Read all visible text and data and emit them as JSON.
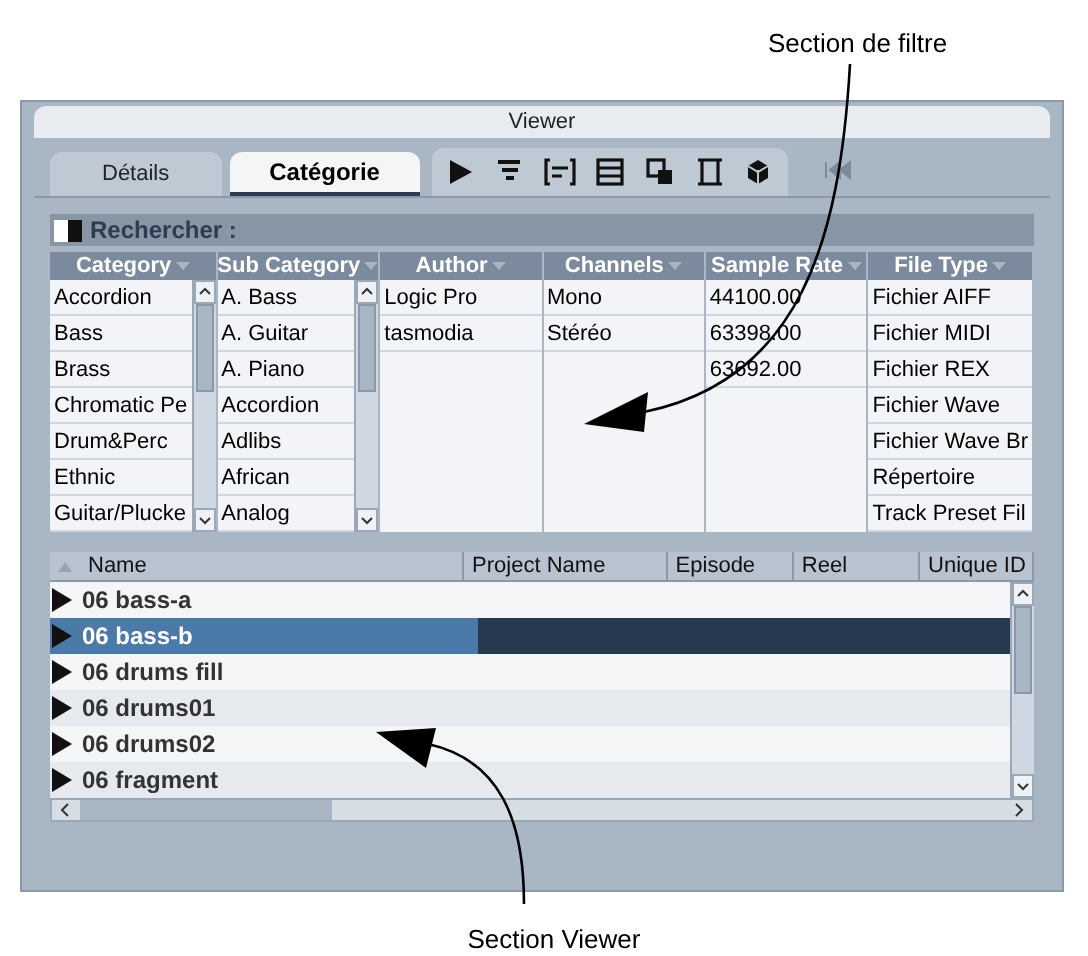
{
  "window": {
    "title": "Viewer"
  },
  "tabs": [
    {
      "label": "Détails",
      "selected": false
    },
    {
      "label": "Catégorie",
      "selected": true
    }
  ],
  "search": {
    "label": "Rechercher :"
  },
  "filter_columns": [
    {
      "header": "Category",
      "kind": "scroll-list",
      "items": [
        "Accordion",
        "Bass",
        "Brass",
        "Chromatic Pe",
        "Drum&Perc",
        "Ethnic",
        "Guitar/Plucke"
      ]
    },
    {
      "header": "Sub Category",
      "kind": "scroll-list",
      "items": [
        "A. Bass",
        "A. Guitar",
        "A. Piano",
        "Accordion",
        "Adlibs",
        "African",
        "Analog"
      ]
    },
    {
      "header": "Author",
      "kind": "list",
      "items": [
        "Logic Pro",
        "tasmodia"
      ]
    },
    {
      "header": "Channels",
      "kind": "list",
      "items": [
        "Mono",
        "Stéréo"
      ]
    },
    {
      "header": "Sample Rate",
      "kind": "list",
      "items": [
        "44100.00",
        "63398.00",
        "63692.00"
      ]
    },
    {
      "header": "File Type",
      "kind": "list",
      "items": [
        "Fichier AIFF",
        "Fichier MIDI",
        "Fichier REX",
        "Fichier Wave",
        "Fichier Wave Br",
        "Répertoire",
        "Track Preset Fil"
      ]
    }
  ],
  "results": {
    "columns": [
      "Name",
      "Project Name",
      "Episode",
      "Reel",
      "Unique ID"
    ],
    "rows": [
      {
        "name": "06 bass-a",
        "selected": false
      },
      {
        "name": "06 bass-b",
        "selected": true
      },
      {
        "name": "06 drums fill",
        "selected": false
      },
      {
        "name": "06 drums01",
        "selected": false
      },
      {
        "name": "06 drums02",
        "selected": false
      },
      {
        "name": "06 fragment",
        "selected": false
      }
    ]
  },
  "annotations": [
    {
      "text": "Section de filtre"
    },
    {
      "text": "Section Viewer"
    }
  ]
}
